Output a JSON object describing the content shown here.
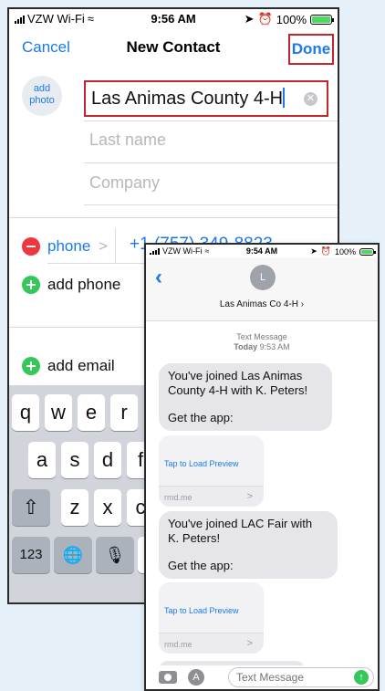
{
  "contact": {
    "status": {
      "carrier": "VZW Wi-Fi",
      "time": "9:56 AM",
      "battery": "100%"
    },
    "nav": {
      "cancel": "Cancel",
      "title": "New Contact",
      "done": "Done"
    },
    "add_photo": "add photo",
    "fields": {
      "first_name": "Las Animas County 4-H",
      "last_name_placeholder": "Last name",
      "company_placeholder": "Company"
    },
    "phone": {
      "label": "phone",
      "chevron": ">",
      "number": "+1 (757) 349-8823"
    },
    "add_phone": "add phone",
    "add_email": "add email",
    "keyboard": {
      "row1": [
        "q",
        "w",
        "e",
        "r"
      ],
      "row2": [
        "a",
        "s",
        "d",
        "f"
      ],
      "row3": [
        "z",
        "x",
        "c"
      ],
      "numbers_key": "123",
      "shift_icon": "⇧",
      "globe_icon": "🌐",
      "mic_icon": "🎙"
    }
  },
  "messages": {
    "status": {
      "carrier": "VZW Wi-Fi",
      "time": "9:54 AM",
      "battery": "100%"
    },
    "header": {
      "avatar_initial": "L",
      "contact_name": "Las Animas Co 4-H ›"
    },
    "meta": {
      "kind": "Text Message",
      "day": "Today",
      "time": "9:53 AM"
    },
    "thread": [
      {
        "line1": "You've joined Las Animas",
        "line2": "County 4-H with K. Peters!",
        "line3": "Get the app:"
      },
      {
        "line1": "You've joined LAC Fair with",
        "line2": "K. Peters!",
        "line3": "Get the app:"
      }
    ],
    "preview": {
      "tap": "Tap to Load Preview",
      "domain": "rmd.me",
      "chevron": ">"
    },
    "input": {
      "placeholder": "Text Message"
    }
  },
  "colors": {
    "accent": "#1a7aec",
    "highlight": "#c0262d",
    "green": "#34c759",
    "red": "#f0353f"
  }
}
